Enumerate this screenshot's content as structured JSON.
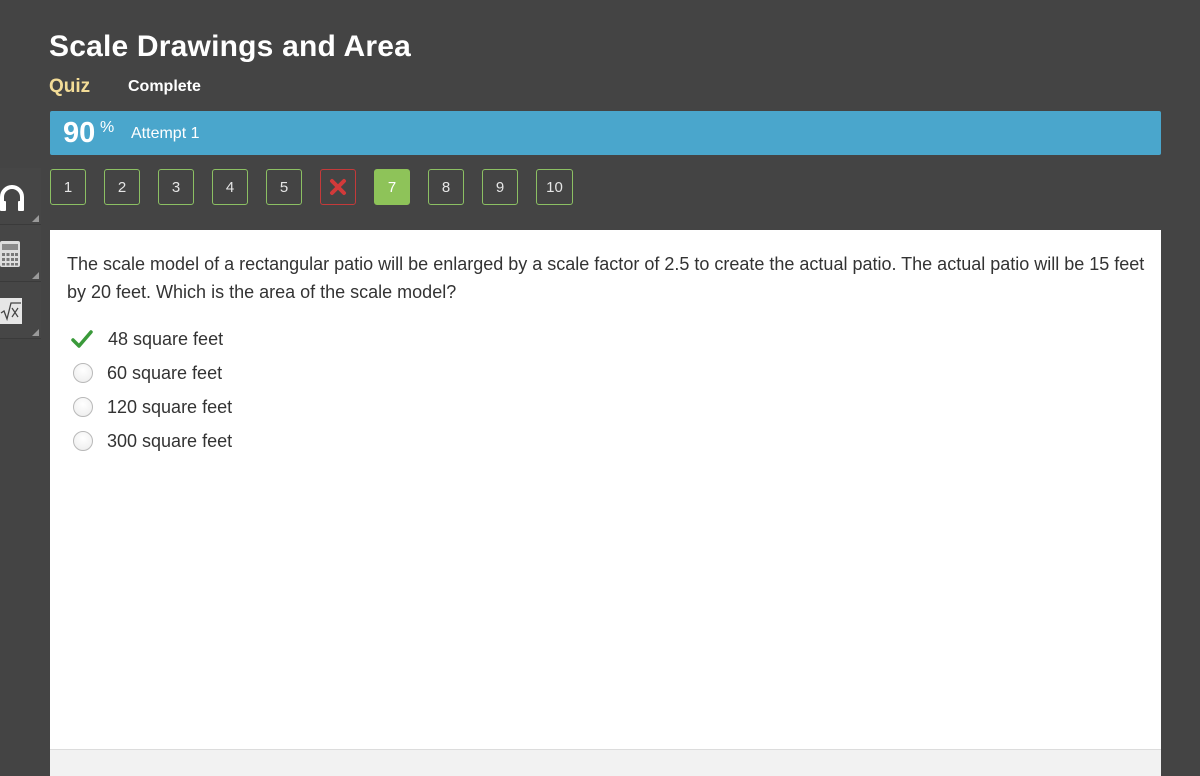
{
  "header": {
    "title": "Scale Drawings and Area",
    "type_label": "Quiz",
    "status_label": "Complete"
  },
  "score": {
    "value": "90",
    "percent_sign": "%",
    "attempt": "Attempt 1"
  },
  "question_nav": [
    {
      "label": "1",
      "state": "answered"
    },
    {
      "label": "2",
      "state": "answered"
    },
    {
      "label": "3",
      "state": "answered"
    },
    {
      "label": "4",
      "state": "answered"
    },
    {
      "label": "5",
      "state": "answered"
    },
    {
      "label": "",
      "state": "incorrect",
      "icon": "x-icon"
    },
    {
      "label": "7",
      "state": "current"
    },
    {
      "label": "8",
      "state": "answered"
    },
    {
      "label": "9",
      "state": "answered"
    },
    {
      "label": "10",
      "state": "answered"
    }
  ],
  "toolbar": [
    {
      "icon": "headphones-icon"
    },
    {
      "icon": "calculator-icon"
    },
    {
      "icon": "formula-icon"
    }
  ],
  "question": {
    "text": "The scale model of a rectangular patio will be enlarged by a scale factor of 2.5 to create the actual patio. The actual patio will be 15 feet by 20 feet. Which is the area of the scale model?",
    "answers": [
      {
        "text": "48 square feet",
        "selected": true,
        "correct": true
      },
      {
        "text": "60 square feet",
        "selected": false
      },
      {
        "text": "120 square feet",
        "selected": false
      },
      {
        "text": "300 square feet",
        "selected": false
      }
    ]
  },
  "colors": {
    "background": "#444444",
    "score_bar": "#4aa6cc",
    "type_label": "#f3dc97",
    "nav_border": "#8cc063",
    "nav_current": "#8ec359",
    "nav_incorrect": "#c43a3a",
    "check": "#3a9a3a"
  }
}
